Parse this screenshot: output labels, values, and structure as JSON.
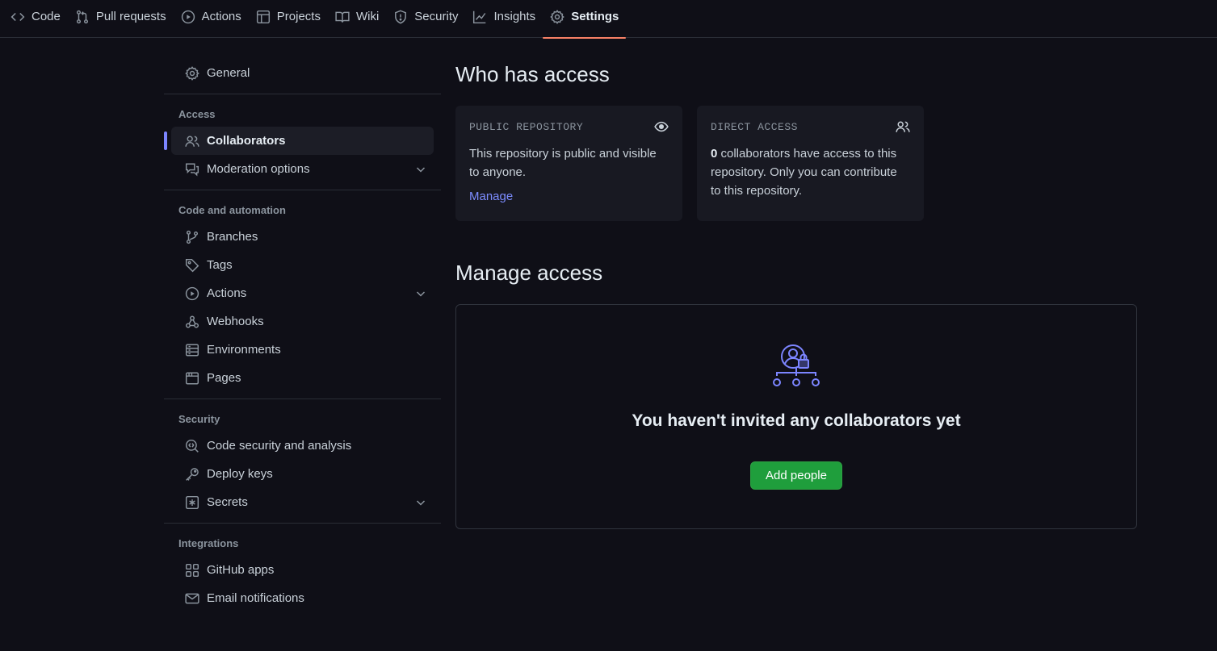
{
  "topnav": {
    "tabs": [
      {
        "label": "Code",
        "icon": "code-icon"
      },
      {
        "label": "Pull requests",
        "icon": "pull-request-icon"
      },
      {
        "label": "Actions",
        "icon": "play-icon"
      },
      {
        "label": "Projects",
        "icon": "table-icon"
      },
      {
        "label": "Wiki",
        "icon": "book-icon"
      },
      {
        "label": "Security",
        "icon": "shield-icon"
      },
      {
        "label": "Insights",
        "icon": "graph-icon"
      },
      {
        "label": "Settings",
        "icon": "gear-icon",
        "active": true
      }
    ]
  },
  "sidebar": {
    "general": "General",
    "sections": {
      "access": "Access",
      "code_automation": "Code and automation",
      "security": "Security",
      "integrations": "Integrations"
    },
    "items": {
      "collaborators": "Collaborators",
      "moderation": "Moderation options",
      "branches": "Branches",
      "tags": "Tags",
      "actions": "Actions",
      "webhooks": "Webhooks",
      "environments": "Environments",
      "pages": "Pages",
      "code_security": "Code security and analysis",
      "deploy_keys": "Deploy keys",
      "secrets": "Secrets",
      "github_apps": "GitHub apps",
      "email_notifications": "Email notifications"
    }
  },
  "main": {
    "who_title": "Who has access",
    "public_card": {
      "title": "PUBLIC REPOSITORY",
      "body": "This repository is public and visible to anyone.",
      "link": "Manage"
    },
    "direct_card": {
      "title": "DIRECT ACCESS",
      "count": "0",
      "body": " collaborators have access to this repository. Only you can contribute to this repository."
    },
    "manage_title": "Manage access",
    "empty_title": "You haven't invited any collaborators yet",
    "add_button": "Add people"
  },
  "colors": {
    "background": "#0f0f17",
    "accent_tab": "#f78166",
    "selected_bar": "#7c85ff",
    "link": "#7c8cff",
    "button_green": "#1f9e3c"
  }
}
